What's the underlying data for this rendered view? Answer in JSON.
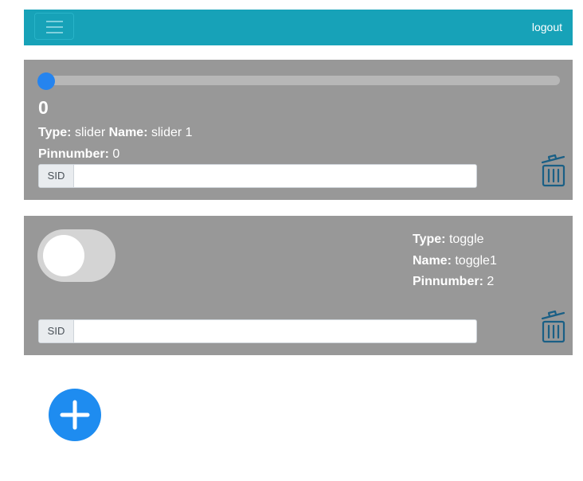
{
  "navbar": {
    "menu_icon": "hamburger-menu-icon",
    "logout_label": "logout",
    "color": "#17a2b8"
  },
  "devices": [
    {
      "slider_value": 0,
      "slider_fraction": 0.0,
      "value_text": "0",
      "type_label": "Type:",
      "type_value": "slider",
      "name_label": "Name:",
      "name_value": "slider 1",
      "pin_label": "Pinnumber:",
      "pin_value": "0",
      "sid_label": "SID",
      "sid_value": "",
      "delete_icon": "trash-icon"
    },
    {
      "toggle_state": "off",
      "type_label": "Type:",
      "type_value": "toggle",
      "name_label": "Name:",
      "name_value": "toggle1",
      "pin_label": "Pinnumber:",
      "pin_value": "2",
      "sid_label": "SID",
      "sid_value": "",
      "delete_icon": "trash-icon"
    }
  ],
  "add_button": {
    "icon": "plus-icon",
    "color": "#1e8cf0"
  },
  "colors": {
    "card_background": "#989898",
    "slider_thumb": "#2584ef",
    "trash_icon": "#1a5f85"
  }
}
